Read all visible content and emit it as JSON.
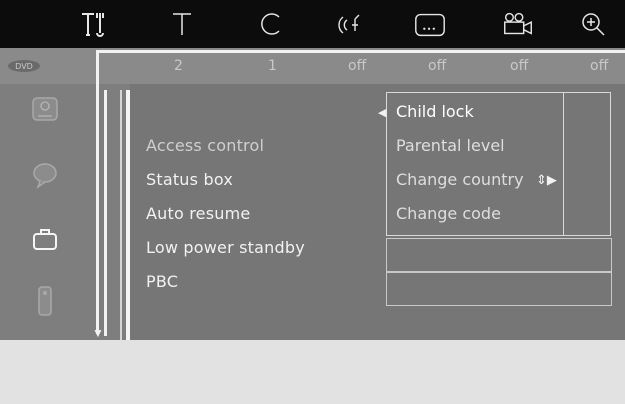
{
  "topbar": {
    "icons": [
      {
        "name": "tools-icon",
        "glyph": "T‡"
      },
      {
        "name": "text-icon",
        "glyph": "T"
      },
      {
        "name": "c-icon",
        "glyph": "C"
      },
      {
        "name": "audio-icon",
        "glyph": "((‹"
      },
      {
        "name": "subtitle-icon",
        "glyph": "..."
      },
      {
        "name": "camera-angle-icon",
        "glyph": ""
      },
      {
        "name": "zoom-icon",
        "glyph": "⊕"
      }
    ]
  },
  "strip": {
    "values": [
      "2",
      "1",
      "off",
      "off",
      "off",
      "off"
    ]
  },
  "menu": {
    "items": [
      {
        "label": "Access control",
        "state": "selected"
      },
      {
        "label": "Status box",
        "state": "normal"
      },
      {
        "label": "Auto resume",
        "state": "normal"
      },
      {
        "label": "Low power standby",
        "state": "normal"
      },
      {
        "label": "PBC",
        "state": "normal"
      }
    ]
  },
  "submenu": {
    "items": [
      {
        "label": "Child lock"
      },
      {
        "label": "Parental level"
      },
      {
        "label": "Change country"
      },
      {
        "label": "Change code"
      }
    ],
    "left_arrow": "◀",
    "right_arrows": "⇕▶"
  },
  "colors": {
    "topbar": "#0c0c0c",
    "panel": "#767676",
    "text": "#f2f2f2"
  }
}
